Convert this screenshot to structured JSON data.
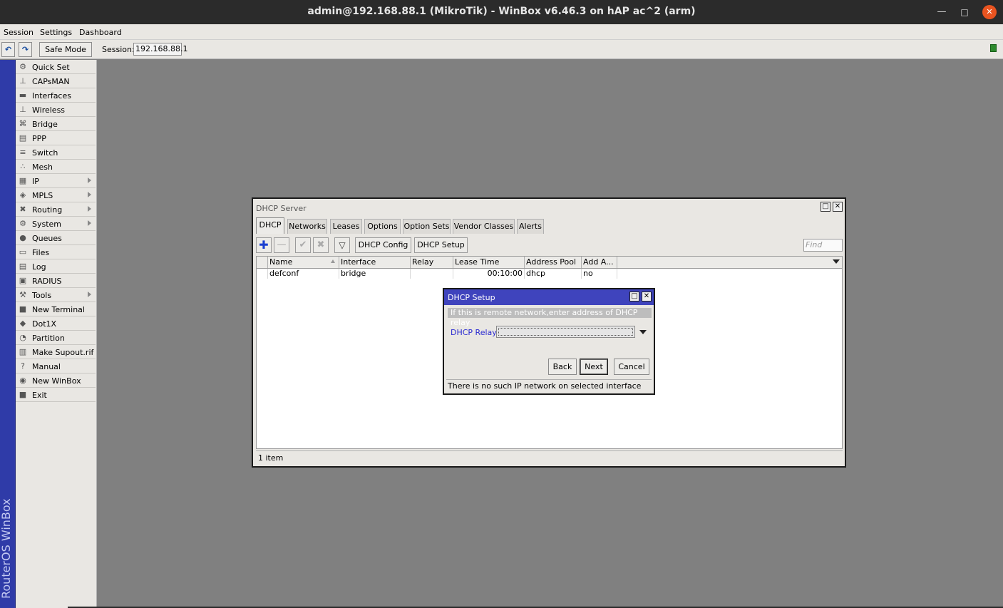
{
  "window": {
    "title": "admin@192.168.88.1 (MikroTik) - WinBox v6.46.3 on hAP ac^2 (arm)",
    "minimize_glyph": "—",
    "maximize_glyph": "□",
    "close_glyph": "✕"
  },
  "menubar": [
    "Session",
    "Settings",
    "Dashboard"
  ],
  "toolbar": {
    "undo_glyph": "↶",
    "redo_glyph": "↷",
    "safe_mode": "Safe Mode",
    "session_label": "Session:",
    "session_value": "192.168.88.1",
    "status_color": "#2d8a2d"
  },
  "brand": "RouterOS WinBox",
  "sidemenu": [
    {
      "label": "Quick Set",
      "icon": "quickset-icon",
      "glyph": "⚙"
    },
    {
      "label": "CAPsMAN",
      "icon": "antenna-icon",
      "glyph": "⊥"
    },
    {
      "label": "Interfaces",
      "icon": "interface-icon",
      "glyph": "▬"
    },
    {
      "label": "Wireless",
      "icon": "wireless-icon",
      "glyph": "⊥"
    },
    {
      "label": "Bridge",
      "icon": "bridge-icon",
      "glyph": "⌘"
    },
    {
      "label": "PPP",
      "icon": "ppp-icon",
      "glyph": "▤"
    },
    {
      "label": "Switch",
      "icon": "switch-icon",
      "glyph": "≡"
    },
    {
      "label": "Mesh",
      "icon": "mesh-icon",
      "glyph": "∴"
    },
    {
      "label": "IP",
      "icon": "ip-icon",
      "glyph": "▦",
      "submenu": true
    },
    {
      "label": "MPLS",
      "icon": "mpls-icon",
      "glyph": "◈",
      "submenu": true
    },
    {
      "label": "Routing",
      "icon": "routing-icon",
      "glyph": "✖",
      "submenu": true
    },
    {
      "label": "System",
      "icon": "system-icon",
      "glyph": "⚙",
      "submenu": true
    },
    {
      "label": "Queues",
      "icon": "queues-icon",
      "glyph": "●"
    },
    {
      "label": "Files",
      "icon": "files-icon",
      "glyph": "▭"
    },
    {
      "label": "Log",
      "icon": "log-icon",
      "glyph": "▤"
    },
    {
      "label": "RADIUS",
      "icon": "radius-icon",
      "glyph": "▣"
    },
    {
      "label": "Tools",
      "icon": "tools-icon",
      "glyph": "⚒",
      "submenu": true
    },
    {
      "label": "New Terminal",
      "icon": "terminal-icon",
      "glyph": "■"
    },
    {
      "label": "Dot1X",
      "icon": "dot1x-icon",
      "glyph": "◆"
    },
    {
      "label": "Partition",
      "icon": "partition-icon",
      "glyph": "◔"
    },
    {
      "label": "Make Supout.rif",
      "icon": "supout-icon",
      "glyph": "▥"
    },
    {
      "label": "Manual",
      "icon": "help-icon",
      "glyph": "?"
    },
    {
      "label": "New WinBox",
      "icon": "winbox-icon",
      "glyph": "◉"
    },
    {
      "label": "Exit",
      "icon": "exit-icon",
      "glyph": "■"
    }
  ],
  "dhcp_window": {
    "title": "DHCP Server",
    "restore_glyph": "□",
    "close_glyph": "✕",
    "tabs": [
      "DHCP",
      "Networks",
      "Leases",
      "Options",
      "Option Sets",
      "Vendor Classes",
      "Alerts"
    ],
    "active_tab": "DHCP",
    "actions": {
      "add_glyph": "✚",
      "remove_glyph": "—",
      "enable_glyph": "✔",
      "disable_glyph": "✖",
      "filter_glyph": "▽",
      "dhcp_config": "DHCP Config",
      "dhcp_setup": "DHCP Setup",
      "find_placeholder": "Find"
    },
    "columns": [
      "Name",
      "Interface",
      "Relay",
      "Lease Time",
      "Address Pool",
      "Add A..."
    ],
    "rows": [
      {
        "name": "defconf",
        "interface": "bridge",
        "relay": "",
        "lease_time": "00:10:00",
        "address_pool": "dhcp",
        "add_arp": "no"
      }
    ],
    "footer": "1 item"
  },
  "dhcp_setup": {
    "title": "DHCP Setup",
    "restore_glyph": "□",
    "close_glyph": "✕",
    "hint": "If this is remote network,enter address of DHCP relay",
    "relay_label": "DHCP Relay:",
    "relay_value": "",
    "buttons": {
      "back": "Back",
      "next": "Next",
      "cancel": "Cancel"
    },
    "status": "There is no such IP network on selected interface"
  }
}
